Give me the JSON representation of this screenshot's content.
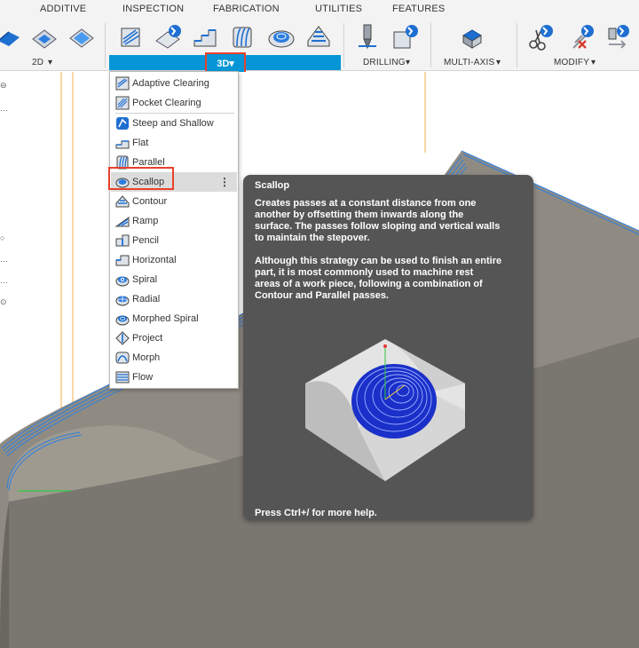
{
  "tabs": [
    {
      "label": "ADDITIVE"
    },
    {
      "label": "INSPECTION"
    },
    {
      "label": "FABRICATION"
    },
    {
      "label": "UTILITIES"
    },
    {
      "label": "FEATURES"
    }
  ],
  "ribbon": {
    "group_2d": "2D",
    "group_3d": "3D",
    "group_drilling": "DRILLING",
    "group_multiaxis": "MULTI-AXIS",
    "group_modify": "MODIFY"
  },
  "menu": {
    "items": [
      {
        "label": "Adaptive Clearing",
        "icon": "adaptive-clearing-icon"
      },
      {
        "label": "Pocket Clearing",
        "icon": "pocket-clearing-icon"
      },
      {
        "label": "Steep and Shallow",
        "icon": "steep-and-shallow-icon"
      },
      {
        "label": "Flat",
        "icon": "flat-icon"
      },
      {
        "label": "Parallel",
        "icon": "parallel-icon"
      },
      {
        "label": "Scallop",
        "icon": "scallop-icon",
        "selected": true
      },
      {
        "label": "Contour",
        "icon": "contour-icon"
      },
      {
        "label": "Ramp",
        "icon": "ramp-icon"
      },
      {
        "label": "Pencil",
        "icon": "pencil-icon"
      },
      {
        "label": "Horizontal",
        "icon": "horizontal-icon"
      },
      {
        "label": "Spiral",
        "icon": "spiral-icon"
      },
      {
        "label": "Radial",
        "icon": "radial-icon"
      },
      {
        "label": "Morphed Spiral",
        "icon": "morphed-spiral-icon"
      },
      {
        "label": "Project",
        "icon": "project-icon"
      },
      {
        "label": "Morph",
        "icon": "morph-icon"
      },
      {
        "label": "Flow",
        "icon": "flow-icon"
      }
    ],
    "kebab": "⋮"
  },
  "tooltip": {
    "title": "Scallop",
    "p1_lines": [
      "Creates passes at a constant distance from one",
      "another by offsetting them inwards along the",
      "surface. The passes follow sloping and vertical walls",
      "to maintain the stepover."
    ],
    "p2_lines": [
      "Although this strategy can be used to finish an entire",
      "part, it is most commonly used to machine rest",
      "areas of a work piece, following a combination of",
      "Contour and Parallel passes."
    ],
    "footer": "Press Ctrl+/ for more help."
  },
  "colors": {
    "accent_blue": "#0696d7",
    "highlight_red": "#e8412c",
    "tooltip_bg": "#555555",
    "toolpath_blue": "#2f7fe0"
  }
}
